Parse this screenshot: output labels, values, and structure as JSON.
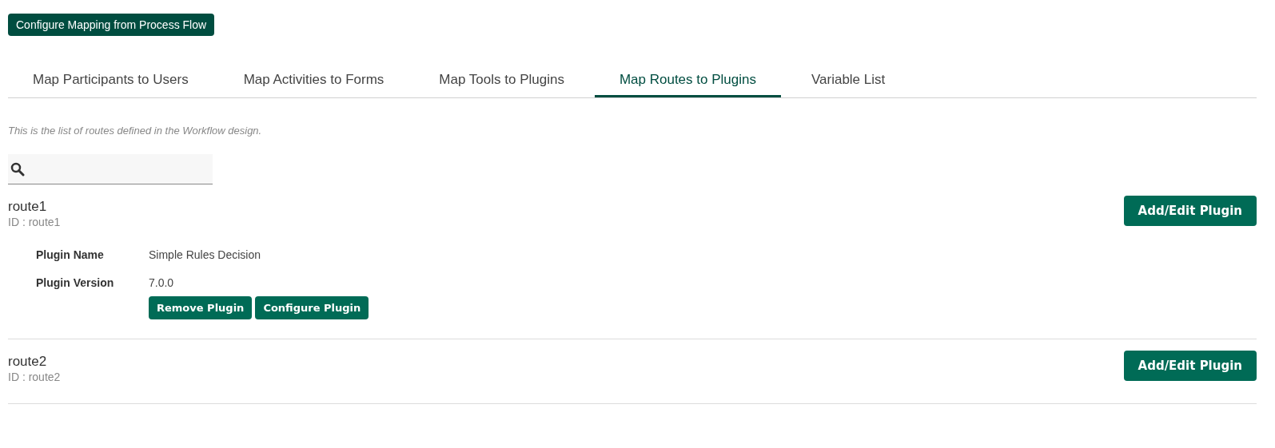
{
  "top_button": "Configure Mapping from Process Flow",
  "tabs": [
    {
      "label": "Map Participants to Users",
      "selected": false
    },
    {
      "label": "Map Activities to Forms",
      "selected": false
    },
    {
      "label": "Map Tools to Plugins",
      "selected": false
    },
    {
      "label": "Map Routes to Plugins",
      "selected": true
    },
    {
      "label": "Variable List",
      "selected": false
    }
  ],
  "description": "This is the list of routes defined in the Workflow design.",
  "routes": [
    {
      "name": "route1",
      "id": "ID : route1",
      "button": "Add/Edit Plugin",
      "plugin": {
        "fields": [
          {
            "label": "Plugin Name",
            "value": "Simple Rules Decision"
          },
          {
            "label": "Plugin Version",
            "value": "7.0.0"
          }
        ],
        "buttons": [
          "Remove Plugin",
          "Configure Plugin"
        ]
      }
    },
    {
      "name": "route2",
      "id": "ID : route2",
      "button": "Add/Edit Plugin"
    }
  ]
}
